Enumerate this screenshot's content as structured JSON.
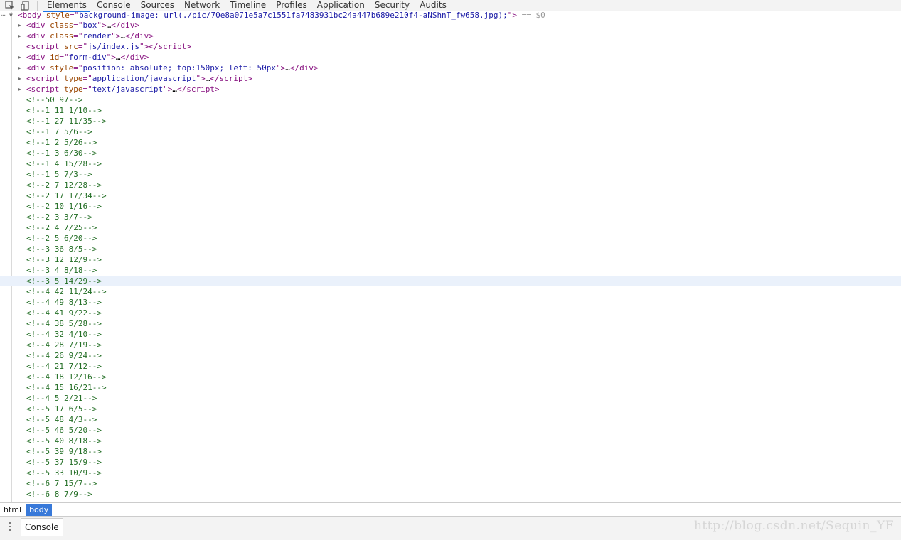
{
  "toolbar": {
    "tabs": [
      "Elements",
      "Console",
      "Sources",
      "Network",
      "Timeline",
      "Profiles",
      "Application",
      "Security",
      "Audits"
    ]
  },
  "tree": {
    "body_line": {
      "tag": "body",
      "attr": "style",
      "value": "background-image: url(./pic/70e8a071e5a7c1551fa7483931bc24a447b689e210f4-aNShnT_fw658.jpg);",
      "suffix": " == $0"
    },
    "children": [
      {
        "type": "element",
        "tag": "div",
        "attrs": [
          {
            "n": "class",
            "v": "box"
          }
        ],
        "collapsed": true
      },
      {
        "type": "element",
        "tag": "div",
        "attrs": [
          {
            "n": "class",
            "v": "render"
          }
        ],
        "collapsed": true
      },
      {
        "type": "script_src",
        "tag": "script",
        "attr": "src",
        "value": "js/index.js"
      },
      {
        "type": "element",
        "tag": "div",
        "attrs": [
          {
            "n": "id",
            "v": "form-div"
          }
        ],
        "collapsed": true
      },
      {
        "type": "element",
        "tag": "div",
        "attrs": [
          {
            "n": "style",
            "v": "position: absolute; top:150px; left: 50px"
          }
        ],
        "collapsed": true
      },
      {
        "type": "element",
        "tag": "script",
        "attrs": [
          {
            "n": "type",
            "v": "application/javascript"
          }
        ],
        "collapsed": true
      },
      {
        "type": "element",
        "tag": "script",
        "attrs": [
          {
            "n": "type",
            "v": "text/javascript"
          }
        ],
        "collapsed": true
      }
    ],
    "comments": [
      "<!--50 97-->",
      "<!--1 11 1/10-->",
      "<!--1 27 11/35-->",
      "<!--1 7 5/6-->",
      "<!--1 2 5/26-->",
      "<!--1 3 6/30-->",
      "<!--1 4 15/28-->",
      "<!--1 5 7/3-->",
      "<!--2 7 12/28-->",
      "<!--2 17 17/34-->",
      "<!--2 10 1/16-->",
      "<!--2 3 3/7-->",
      "<!--2 4 7/25-->",
      "<!--2 5 6/20-->",
      "<!--3 36 8/5-->",
      "<!--3 12 12/9-->",
      "<!--3 4 8/18-->",
      "<!--3 5 14/29-->",
      "<!--4 42 11/24-->",
      "<!--4 49 8/13-->",
      "<!--4 41 9/22-->",
      "<!--4 38 5/28-->",
      "<!--4 32 4/10-->",
      "<!--4 28 7/19-->",
      "<!--4 26 9/24-->",
      "<!--4 21 7/12-->",
      "<!--4 18 12/16-->",
      "<!--4 15 16/21-->",
      "<!--4 5 2/21-->",
      "<!--5 17 6/5-->",
      "<!--5 48 4/3-->",
      "<!--5 46 5/20-->",
      "<!--5 40 8/18-->",
      "<!--5 39 9/18-->",
      "<!--5 37 15/9-->",
      "<!--5 33 10/9-->",
      "<!--6 7 15/7-->",
      "<!--6 8 7/9-->"
    ],
    "highlighted_comment_index": 17,
    "ellipsis": "…"
  },
  "breadcrumbs": [
    "html",
    "body"
  ],
  "drawer": {
    "tab_label": "Console",
    "watermark": "http://blog.csdn.net/Sequin_YF"
  }
}
